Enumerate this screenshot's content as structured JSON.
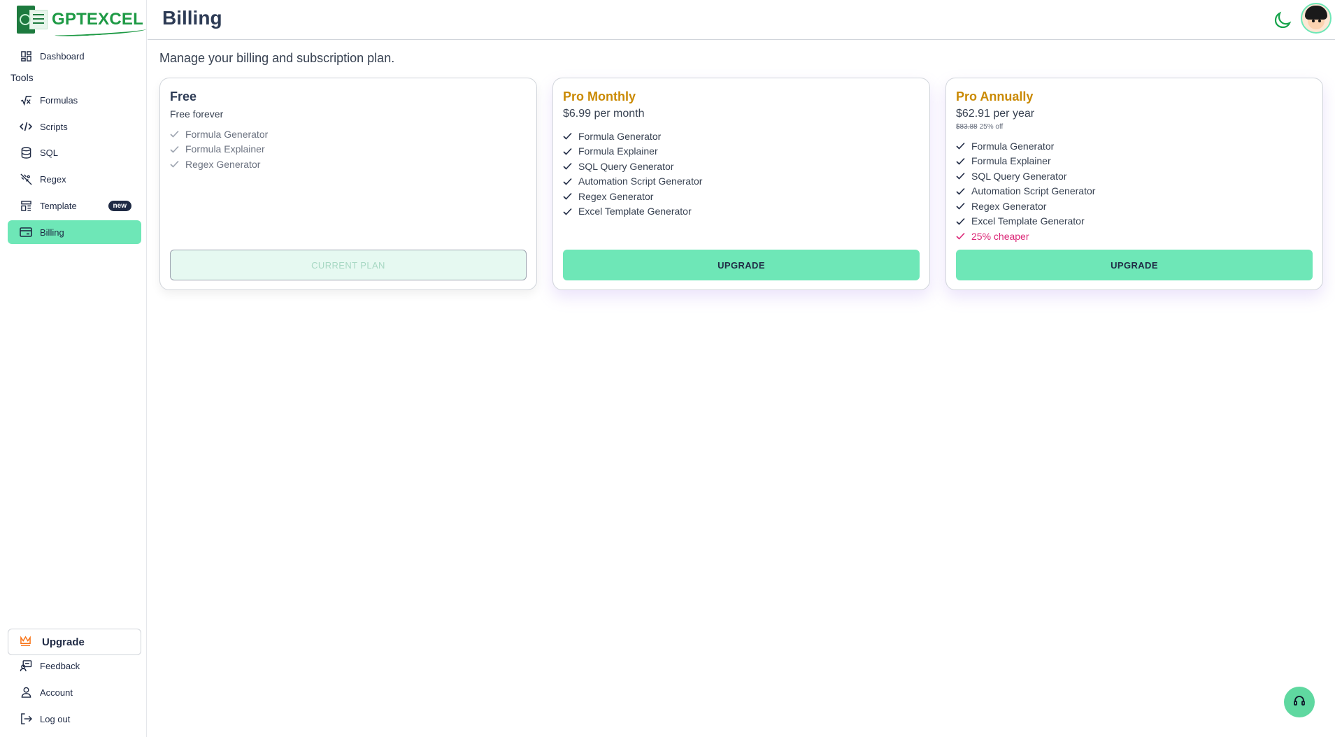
{
  "brand": {
    "name": "GPTEXCEL"
  },
  "sidebar": {
    "dashboard": "Dashboard",
    "section_tools": "Tools",
    "items": [
      {
        "label": "Formulas",
        "icon": "sqrt-x-icon"
      },
      {
        "label": "Scripts",
        "icon": "code-icon"
      },
      {
        "label": "SQL",
        "icon": "database-icon"
      },
      {
        "label": "Regex",
        "icon": "regex-icon"
      },
      {
        "label": "Template",
        "icon": "template-icon",
        "badge": "new"
      },
      {
        "label": "Billing",
        "icon": "card-icon",
        "active": true
      }
    ],
    "upgrade": "Upgrade",
    "feedback": "Feedback",
    "account": "Account",
    "logout": "Log out"
  },
  "header": {
    "title": "Billing"
  },
  "main": {
    "subtitle": "Manage your billing and subscription plan.",
    "plans": [
      {
        "name": "Free",
        "price": "Free forever",
        "features": [
          "Formula Generator",
          "Formula Explainer",
          "Regex Generator"
        ],
        "button": "CURRENT PLAN"
      },
      {
        "name": "Pro Monthly",
        "price": "$6.99 per month",
        "features": [
          "Formula Generator",
          "Formula Explainer",
          "SQL Query Generator",
          "Automation Script Generator",
          "Regex Generator",
          "Excel Template Generator"
        ],
        "button": "UPGRADE"
      },
      {
        "name": "Pro Annually",
        "price": "$62.91 per year",
        "original_price": "$83.88",
        "discount": "25% off",
        "features": [
          "Formula Generator",
          "Formula Explainer",
          "SQL Query Generator",
          "Automation Script Generator",
          "Regex Generator",
          "Excel Template Generator"
        ],
        "highlight": "25% cheaper",
        "button": "UPGRADE"
      }
    ]
  },
  "colors": {
    "accent": "#6ee7b7",
    "brand_green": "#1e9a45",
    "plan_gold": "#ca8a04",
    "highlight_pink": "#db2777"
  }
}
